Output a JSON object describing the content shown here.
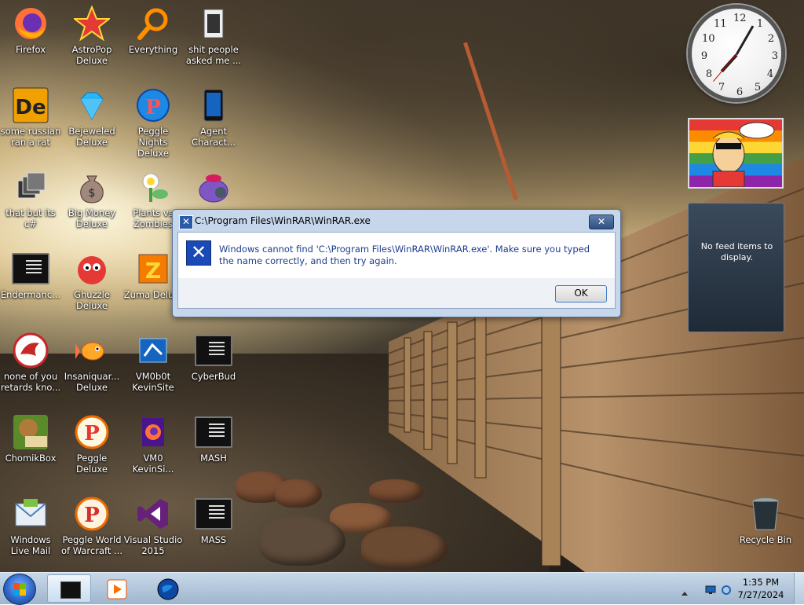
{
  "desktop": {
    "icons": [
      {
        "label": "Firefox",
        "icon": "firefox-icon"
      },
      {
        "label": "AstroPop Deluxe",
        "icon": "astropop-icon"
      },
      {
        "label": "Everything",
        "icon": "search-magnifier-icon"
      },
      {
        "label": "shit people asked me ...",
        "icon": "file-icon"
      },
      {
        "label": "some russian ran a rat",
        "icon": "de-app-icon"
      },
      {
        "label": "Bejeweled Deluxe",
        "icon": "diamond-gem-icon"
      },
      {
        "label": "Peggle Nights Deluxe",
        "icon": "peggle-nights-icon"
      },
      {
        "label": "Agent Charact...",
        "icon": "phone-icon"
      },
      {
        "label": "that but its c#",
        "icon": "windows-stack-icon"
      },
      {
        "label": "Big Money Deluxe",
        "icon": "money-bag-icon"
      },
      {
        "label": "Plants vs Zombies",
        "icon": "plants-vs-zombies-icon"
      },
      {
        "label": "",
        "icon": "purple-bag-icon"
      },
      {
        "label": "Endermanc...",
        "icon": "terminal-icon"
      },
      {
        "label": "Ghuzzle Deluxe",
        "icon": "red-creature-icon"
      },
      {
        "label": "Zuma Delu...",
        "icon": "zuma-icon"
      },
      {
        "label": "none of you retards kno...",
        "icon": "red-dragon-icon"
      },
      {
        "label": "Insaniquar... Deluxe",
        "icon": "goldfish-icon"
      },
      {
        "label": "VM0b0t KevinSite",
        "icon": "vm-icon"
      },
      {
        "label": "CyberBud",
        "icon": "terminal-icon"
      },
      {
        "label": "ChomikBox",
        "icon": "chomikbox-icon"
      },
      {
        "label": "Peggle Deluxe",
        "icon": "peggle-icon"
      },
      {
        "label": "VM0 KevinSi...",
        "icon": "firefox-file-icon"
      },
      {
        "label": "MASH",
        "icon": "terminal-icon"
      },
      {
        "label": "Windows Live Mail",
        "icon": "mail-icon"
      },
      {
        "label": "Peggle World of Warcraft ...",
        "icon": "peggle-icon"
      },
      {
        "label": "Visual Studio 2015",
        "icon": "visual-studio-icon"
      },
      {
        "label": "MASS",
        "icon": "terminal-icon"
      },
      {
        "label": "Recycle Bin",
        "icon": "recycle-bin-icon"
      }
    ]
  },
  "dialog": {
    "title": "C:\\Program Files\\WinRAR\\WinRAR.exe",
    "message": "Windows cannot find 'C:\\Program Files\\WinRAR\\WinRAR.exe'. Make sure you typed the name correctly, and then try again.",
    "ok_label": "OK",
    "close_glyph": "✕",
    "error_glyph": "✕"
  },
  "gadgets": {
    "clock_numbers": [
      "12",
      "1",
      "2",
      "3",
      "4",
      "5",
      "6",
      "7",
      "8",
      "9",
      "10",
      "11"
    ],
    "feed_text": "No feed items to display."
  },
  "taskbar": {
    "time": "1:35 PM",
    "date": "7/27/2024"
  }
}
